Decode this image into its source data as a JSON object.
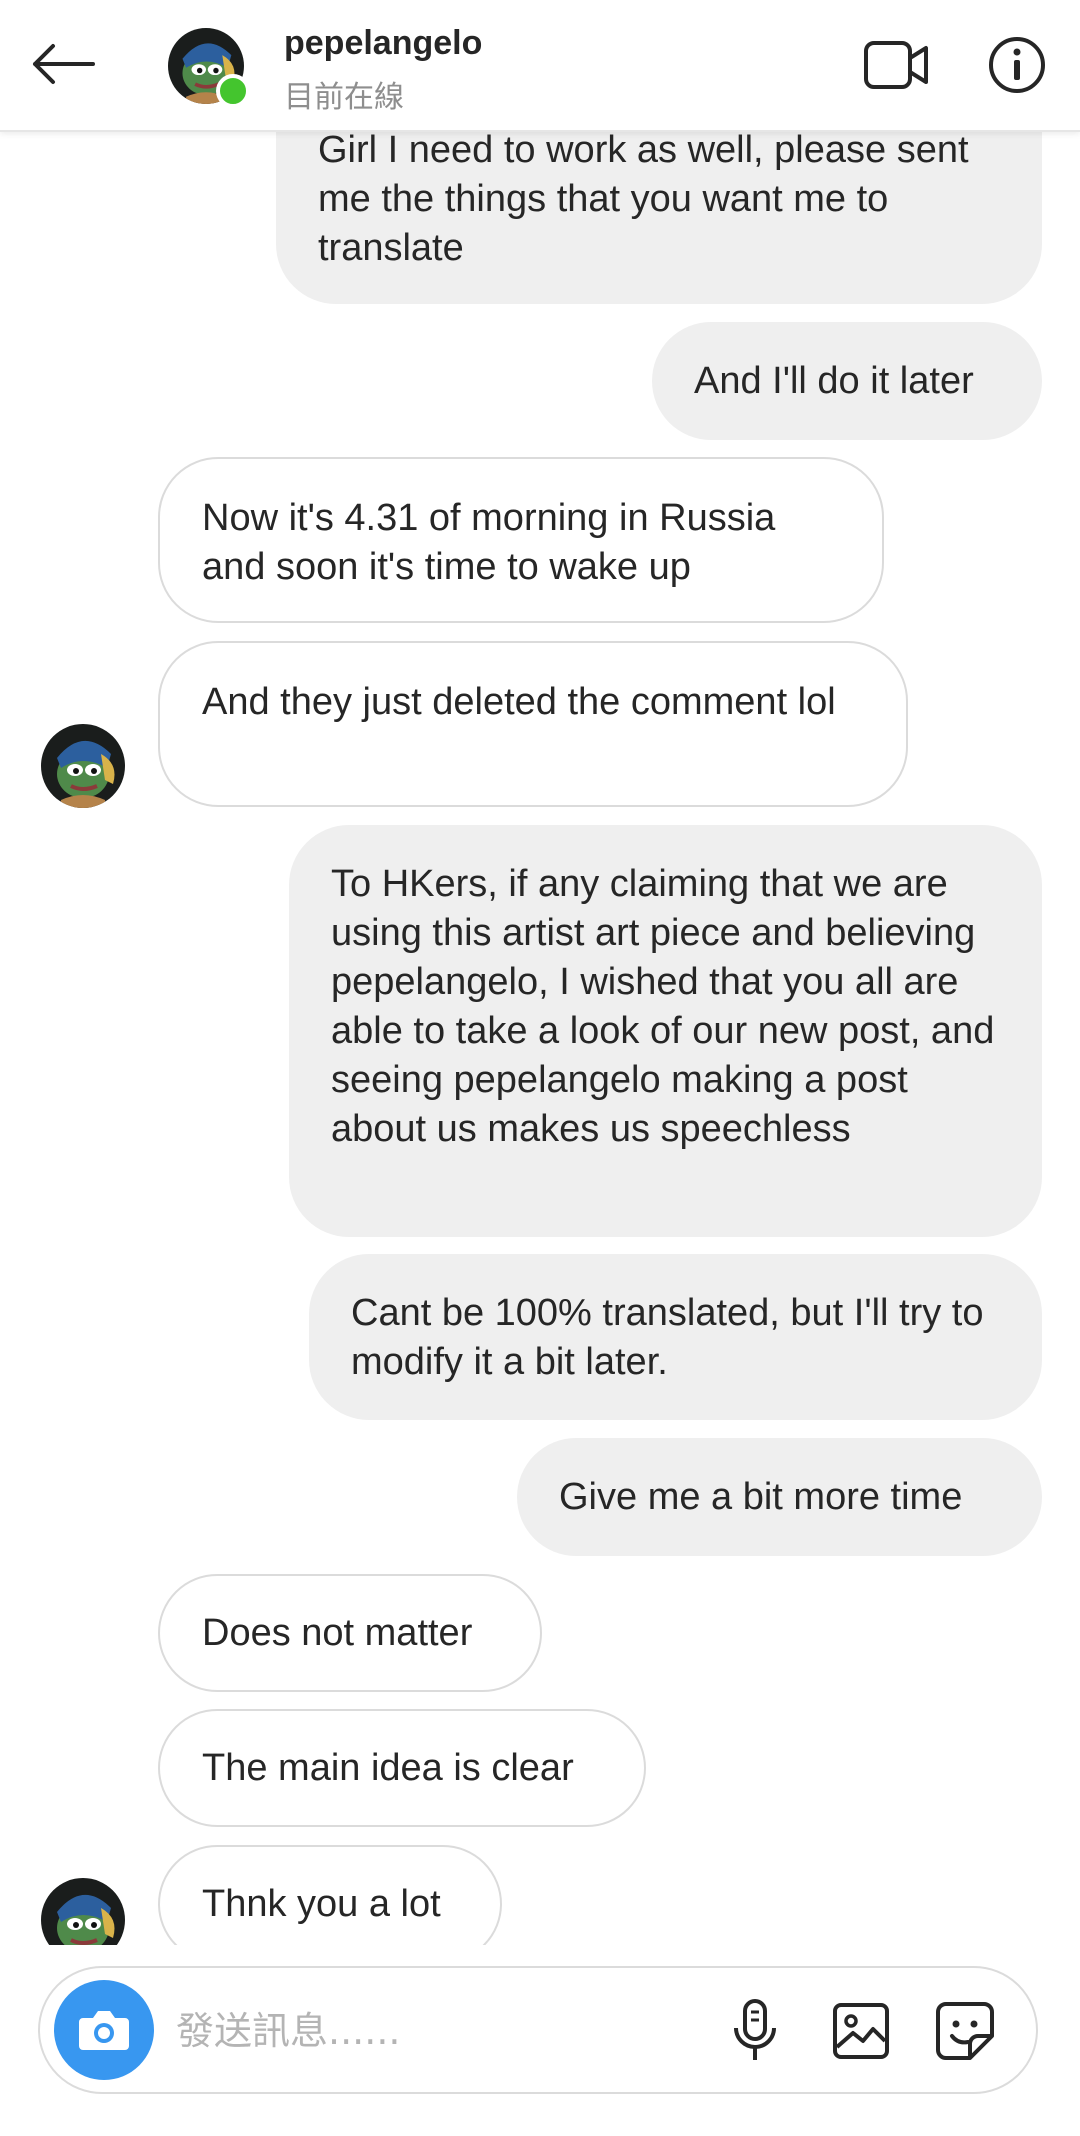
{
  "header": {
    "username": "pepelangelo",
    "status": "目前在線",
    "online_color": "#44c52e",
    "icons": [
      "back-arrow-icon",
      "video-call-icon",
      "info-icon"
    ]
  },
  "messages": [
    {
      "from": "me",
      "text": "Girl I need to work as well, please sent me the things that you want me to translate"
    },
    {
      "from": "me",
      "text": "And I'll do it later"
    },
    {
      "from": "them",
      "text": "Now it's 4.31 of morning in Russia and soon it's time to wake up"
    },
    {
      "from": "them",
      "text": "And they just deleted the comment lol"
    },
    {
      "from": "me",
      "text": "To HKers, if any claiming that we are using this artist art piece and believing pepelangelo, I wished that you all are able to take a look of our new post, and seeing pepelangelo making a post about us makes us speechless"
    },
    {
      "from": "me",
      "text": "Cant be 100% translated, but I'll try to modify it a bit later."
    },
    {
      "from": "me",
      "text": "Give me a bit more time"
    },
    {
      "from": "them",
      "text": "Does not matter"
    },
    {
      "from": "them",
      "text": "The main idea is clear"
    },
    {
      "from": "them",
      "text": "Thnk you a lot"
    }
  ],
  "composer": {
    "placeholder": "發送訊息......",
    "accent_color": "#3897f0",
    "icons": [
      "camera-icon",
      "microphone-icon",
      "photo-gallery-icon",
      "sticker-icon"
    ]
  }
}
